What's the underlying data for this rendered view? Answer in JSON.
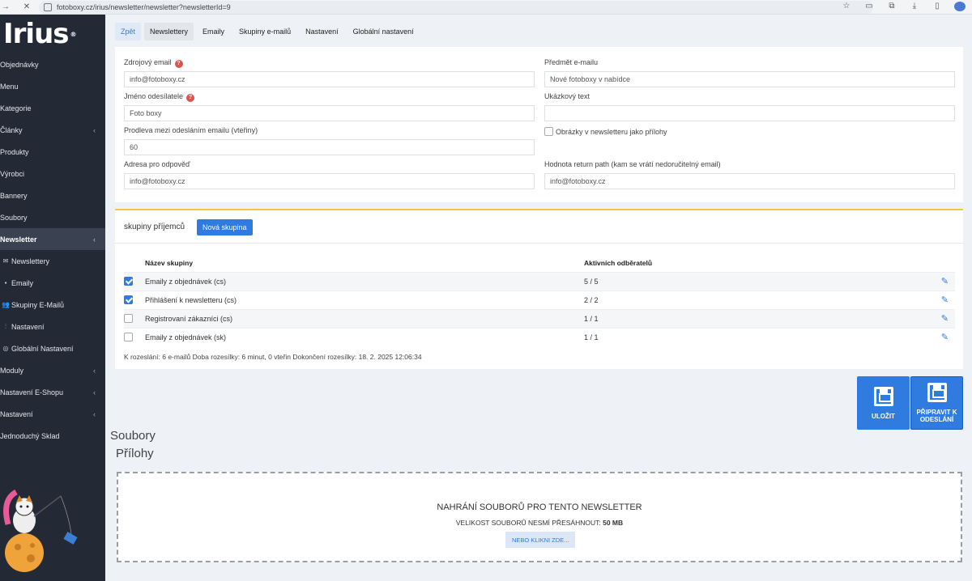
{
  "browser": {
    "url": "fotoboxy.cz/irius/newsletter/newsletter?newsletterId=9"
  },
  "sidebar": {
    "logo": "Irius",
    "logo_mark": "®",
    "items": [
      {
        "label": "Objednávky"
      },
      {
        "label": "Menu"
      },
      {
        "label": "Kategorie"
      },
      {
        "label": "Články",
        "has_children": true
      },
      {
        "label": "Produkty"
      },
      {
        "label": "Výrobci"
      },
      {
        "label": "Bannery"
      },
      {
        "label": "Soubory"
      },
      {
        "label": "Newsletter",
        "has_children": true,
        "active": true
      }
    ],
    "sub_items": [
      {
        "label": "Newslettery",
        "icon": "envelope-icon"
      },
      {
        "label": "Emaily",
        "icon": "list-icon"
      },
      {
        "label": "Skupiny E-Mailů",
        "icon": "users-icon"
      },
      {
        "label": "Nastavení",
        "icon": "sliders-icon"
      },
      {
        "label": "Globální Nastavení",
        "icon": "globe-icon"
      }
    ],
    "bottom_items": [
      {
        "label": "Moduly",
        "has_children": true
      },
      {
        "label": "Nastavení E-Shopu",
        "has_children": true
      },
      {
        "label": "Nastavení",
        "has_children": true
      },
      {
        "label": "Jednoduchý Sklad"
      }
    ]
  },
  "tabs": [
    {
      "label": "Zpět"
    },
    {
      "label": "Newslettery"
    },
    {
      "label": "Emaily"
    },
    {
      "label": "Skupiny e-mailů"
    },
    {
      "label": "Nastavení"
    },
    {
      "label": "Globální nastavení"
    }
  ],
  "form": {
    "source_email_label": "Zdrojový email",
    "source_email_value": "info@fotoboxy.cz",
    "sender_name_label": "Jméno odesílatele",
    "sender_name_value": "Foto boxy",
    "delay_label": "Prodleva mezi odesláním emailu (vteřiny)",
    "delay_value": "60",
    "reply_label": "Adresa pro odpověď",
    "reply_value": "info@fotoboxy.cz",
    "subject_label": "Předmět e-mailu",
    "subject_value": "Nové fotoboxy v nabídce",
    "preview_label": "Ukázkový text",
    "preview_value": "",
    "images_checkbox_label": "Obrázky v newsletteru jako přílohy",
    "images_checked": false,
    "return_path_label": "Hodnota return path (kam se vrátí nedoručitelný email)",
    "return_path_value": "info@fotoboxy.cz",
    "help_glyph": "?"
  },
  "groups": {
    "title": "skupiny příjemců",
    "new_button": "Nová skupina",
    "col_name": "Název skupiny",
    "col_active": "Aktivních odběratelů",
    "rows": [
      {
        "checked": true,
        "name": "Emaily z objednávek (cs)",
        "active": "5 / 5"
      },
      {
        "checked": true,
        "name": "Přihlášení k newsletteru (cs)",
        "active": "2 / 2"
      },
      {
        "checked": false,
        "name": "Registrovaní zákazníci (cs)",
        "active": "1 / 1"
      },
      {
        "checked": false,
        "name": "Emaily z objednávek (sk)",
        "active": "1 / 1"
      }
    ],
    "summary": "K rozeslání: 6 e-mailů Doba rozesílky: 6 minut, 0 vteřin Dokončení rozesílky: 18. 2. 2025 12:06:34"
  },
  "actions": {
    "save": "ULOŽIT",
    "prepare_line1": "PŘIPRAVIT K",
    "prepare_line2": "ODESLÁNÍ"
  },
  "files": {
    "title": "Soubory",
    "attachments_title": "Přílohy",
    "upload_heading": "NAHRÁNÍ SOUBORŮ PRO TENTO NEWSLETTER",
    "size_note": "VELIKOST SOUBORŮ NESMÍ PŘESÁHNOUT:",
    "size_value": "50 MB",
    "click_here": "NEBO KLIKNI ZDE..."
  }
}
